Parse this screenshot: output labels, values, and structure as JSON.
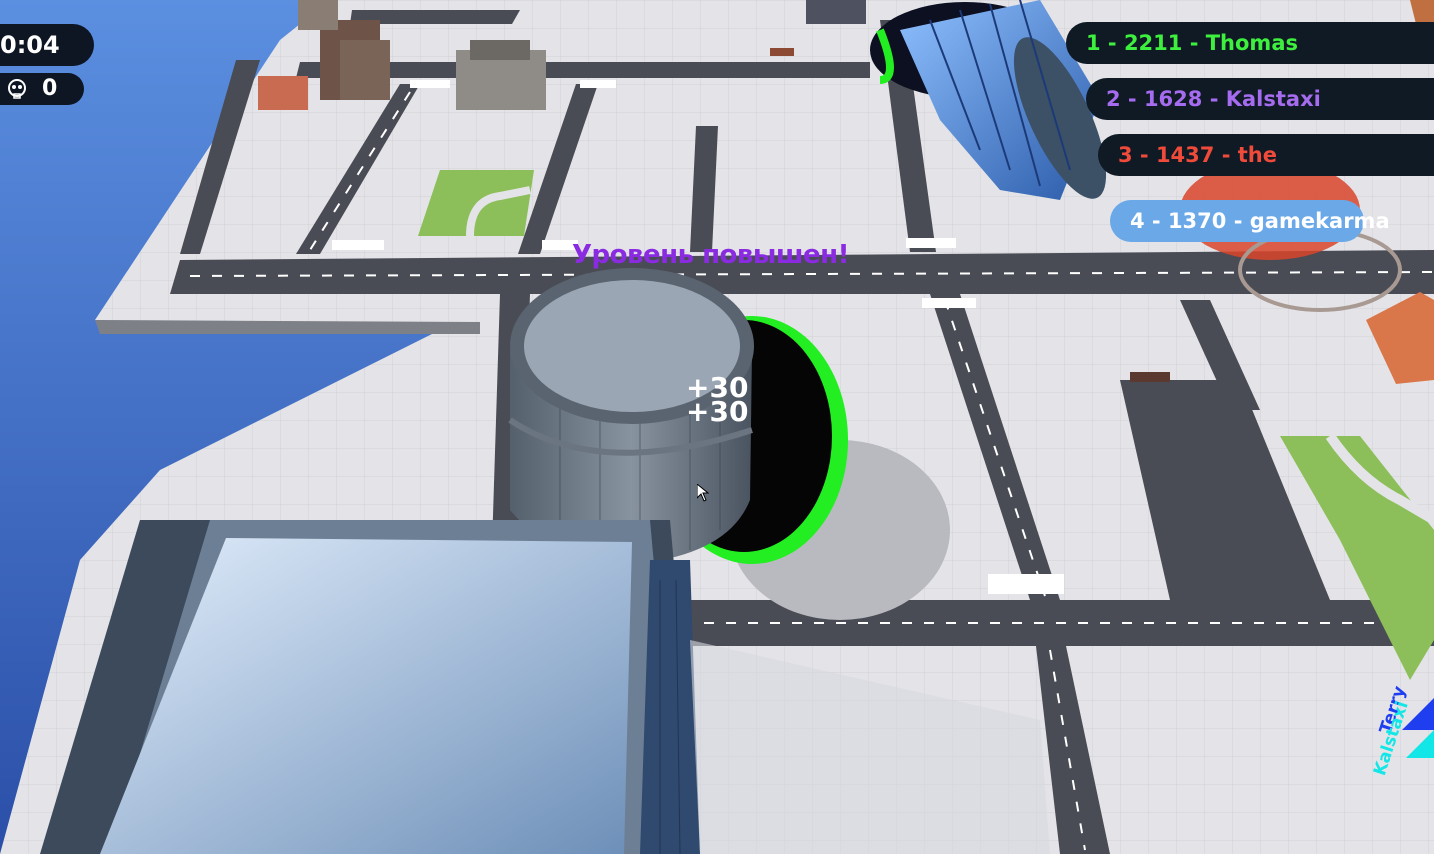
{
  "hud": {
    "timer": "0:04",
    "kills": "0"
  },
  "leaderboard": [
    {
      "text": "1 -  2211 - Thomas",
      "color": "#3ef03e"
    },
    {
      "text": "2 - 1628 - Kalstaxi",
      "color": "#a66cf0"
    },
    {
      "text": "3 -   1437 - the",
      "color": "#f04a3a"
    },
    {
      "text": "4 - 1370 - gamekarma",
      "color": "#ffffff"
    }
  ],
  "notifications": {
    "level_up": "Уровень повышен!",
    "score_popups": [
      "+30",
      "+30"
    ]
  },
  "offscreen_players": {
    "names": [
      "Terry",
      "Kalstaxi"
    ],
    "colors": [
      "#1e3ef0",
      "#12e6e6"
    ]
  },
  "colors": {
    "water": "#2f5fb7",
    "pavement": "#e4e4e8",
    "road": "#4a4c55",
    "grass": "#8cbf5a",
    "hole_ring": "#22ee22",
    "hud_bg": "#0d1622",
    "player_highlight": "#6aa8e8"
  },
  "icons": [
    "skull-icon",
    "mouse-cursor-icon",
    "direction-arrow-icon"
  ]
}
